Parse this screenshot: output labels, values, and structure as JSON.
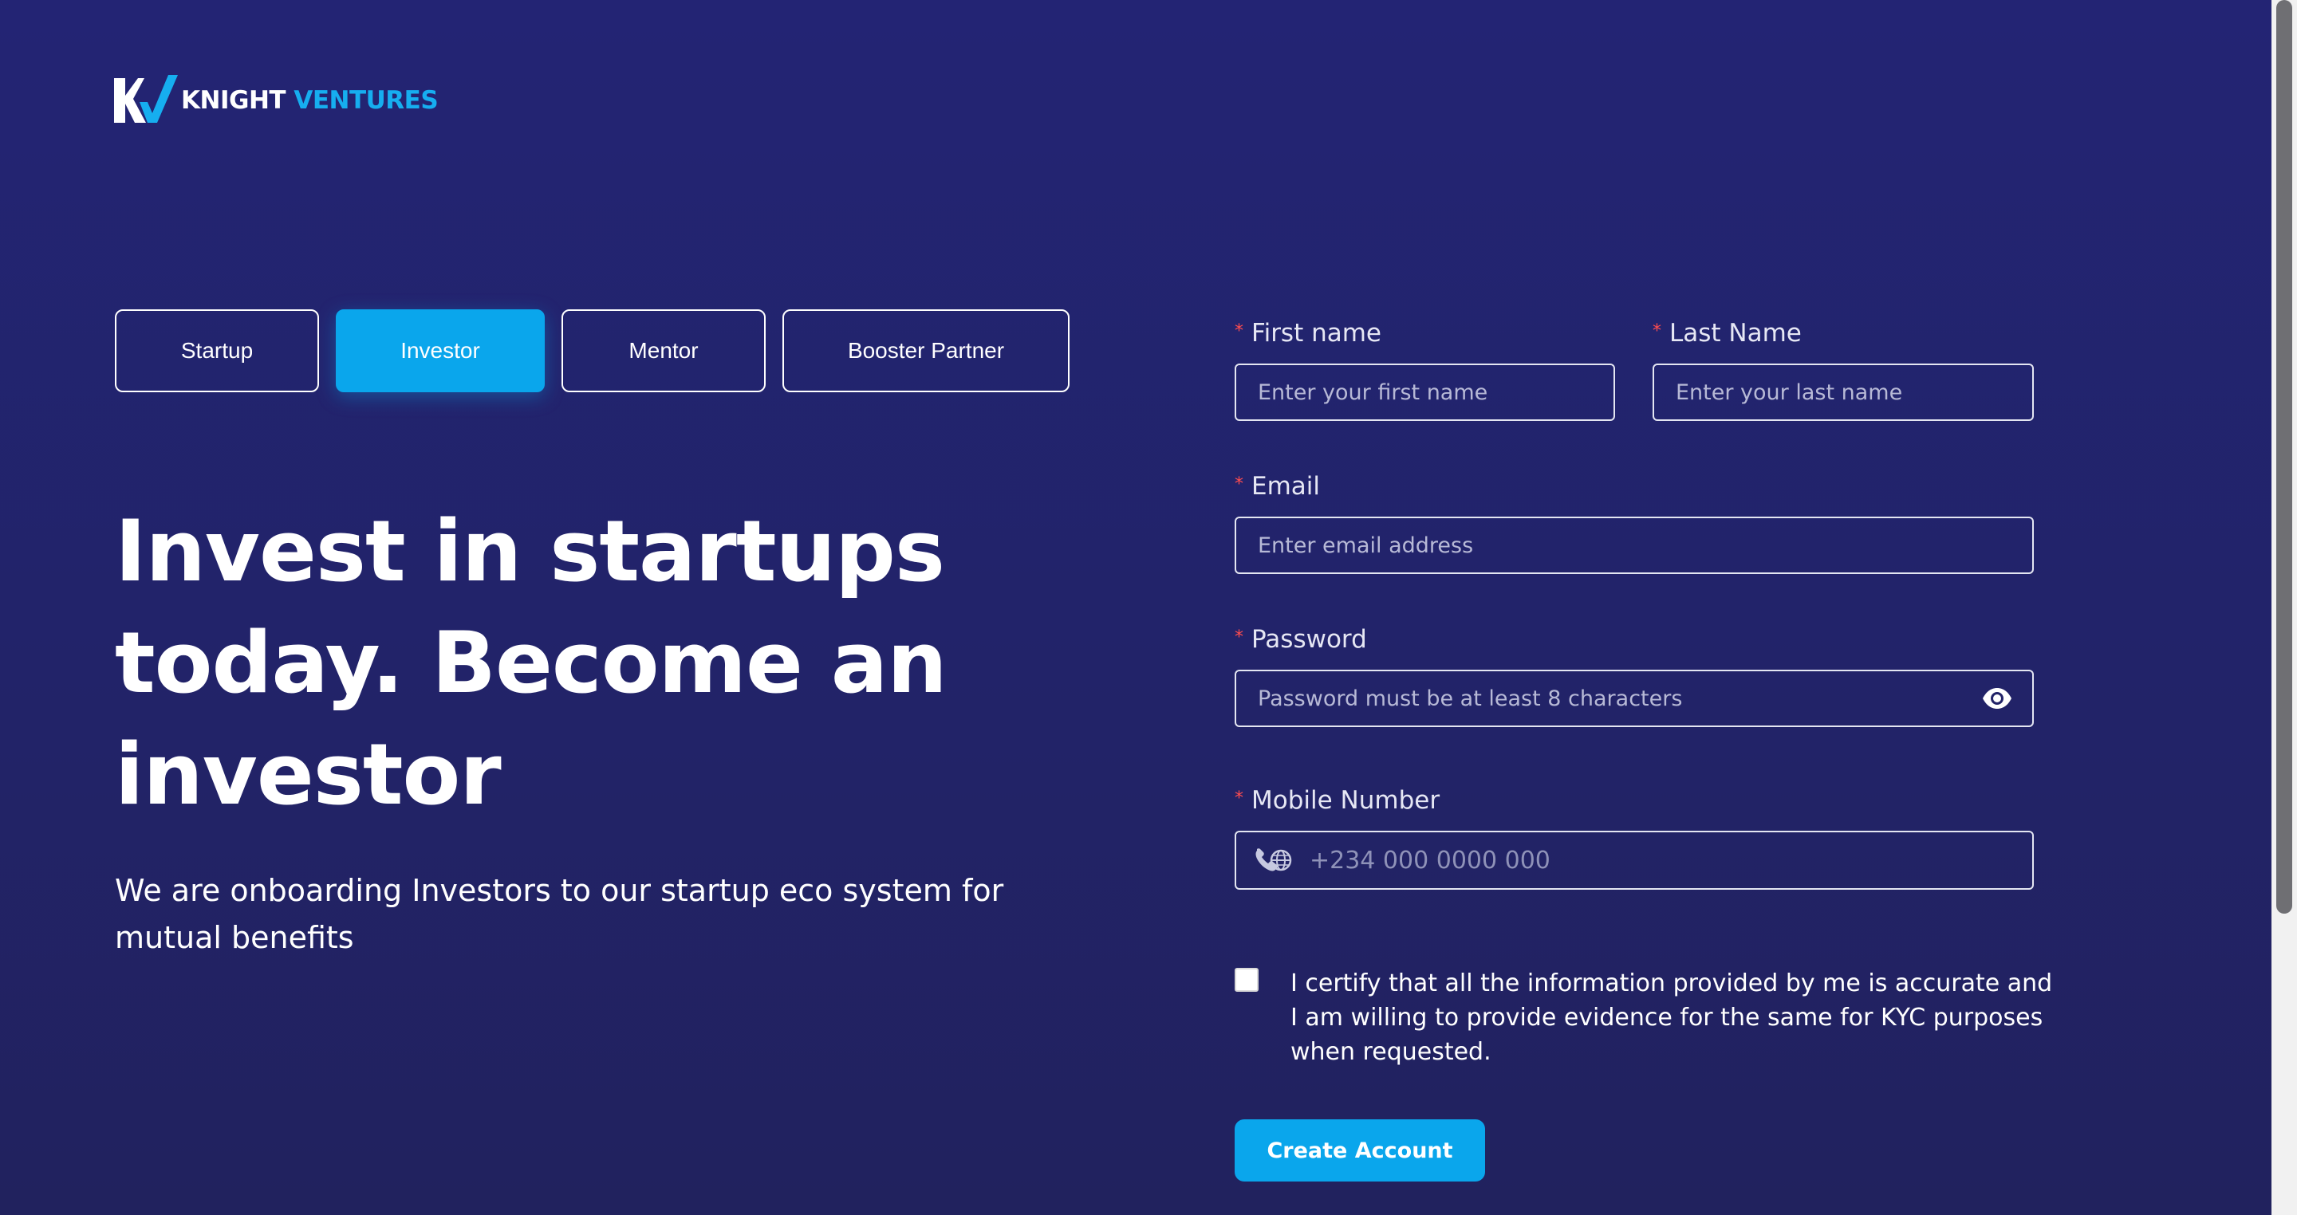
{
  "brand": {
    "name_part1": "KNIGHT",
    "name_part2": "VENTURES",
    "logo_icon": "kv-monogram-icon",
    "accent_color": "#16aef0"
  },
  "role_tabs": {
    "items": [
      {
        "label": "Startup",
        "active": false
      },
      {
        "label": "Investor",
        "active": true
      },
      {
        "label": "Mentor",
        "active": false
      },
      {
        "label": "Booster Partner",
        "active": false
      }
    ]
  },
  "hero": {
    "title": "Invest in startups today. Become an investor",
    "subtitle": "We are onboarding Investors to our startup eco system for mutual benefits"
  },
  "form": {
    "required_marker": "*",
    "first_name": {
      "label": "First name",
      "placeholder": "Enter your first name",
      "value": ""
    },
    "last_name": {
      "label": "Last Name",
      "placeholder": "Enter your last name",
      "value": ""
    },
    "email": {
      "label": "Email",
      "placeholder": "Enter email address",
      "value": ""
    },
    "password": {
      "label": "Password",
      "placeholder": "Password must be at least 8 characters",
      "value": "",
      "toggle_icon": "eye-icon"
    },
    "mobile": {
      "label": "Mobile Number",
      "placeholder": "+234 000 0000 000",
      "value": "",
      "prefix_icon": "phone-globe-icon"
    },
    "certify": {
      "checked": false,
      "text": "I certify that all the information provided by me is accurate and I am willing to provide evidence for the same for KYC purposes when requested."
    },
    "submit_label": "Create Account"
  },
  "colors": {
    "background": "#232474",
    "primary_button": "#0aa6ec",
    "required": "#ff4d4f"
  }
}
